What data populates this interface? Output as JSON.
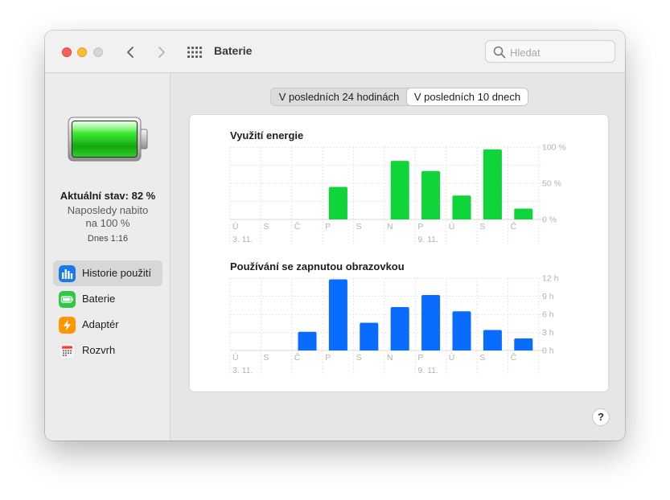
{
  "window": {
    "title": "Baterie"
  },
  "search": {
    "placeholder": "Hledat"
  },
  "sidebar": {
    "status_main": "Aktuální stav: 82 %",
    "status_sub_1": "Naposledy nabito",
    "status_sub_2": "na 100 %",
    "status_time": "Dnes 1:16",
    "items": [
      {
        "label": "Historie použití",
        "icon": "bar-chart-icon",
        "color": "#1778f2",
        "active": true
      },
      {
        "label": "Baterie",
        "icon": "battery-icon",
        "color": "#33c748",
        "active": false
      },
      {
        "label": "Adaptér",
        "icon": "lightning-icon",
        "color": "#ff9500",
        "active": false
      },
      {
        "label": "Rozvrh",
        "icon": "calendar-icon",
        "color": "#f2f2f2",
        "active": false
      }
    ]
  },
  "tabs": [
    {
      "label": "V posledních 24 hodinách",
      "selected": false
    },
    {
      "label": "V posledních 10 dnech",
      "selected": true
    }
  ],
  "help": {
    "label": "?"
  },
  "chart_data": [
    {
      "type": "bar",
      "title": "Využití energie",
      "color": "#0fd43a",
      "categories": [
        "Ú",
        "S",
        "Č",
        "P",
        "S",
        "N",
        "P",
        "Ú",
        "S",
        "Č"
      ],
      "date_labels": [
        {
          "index": 0,
          "text": "3. 11."
        },
        {
          "index": 6,
          "text": "9. 11."
        }
      ],
      "values": [
        0,
        0,
        0,
        45,
        0,
        81,
        67,
        33,
        97,
        15
      ],
      "ylim": [
        0,
        100
      ],
      "yticks": [
        {
          "v": 100,
          "label": "100 %"
        },
        {
          "v": 50,
          "label": "50 %"
        },
        {
          "v": 0,
          "label": "0 %"
        }
      ]
    },
    {
      "type": "bar",
      "title": "Používání se zapnutou obrazovkou",
      "color": "#0a6cff",
      "categories": [
        "Ú",
        "S",
        "Č",
        "P",
        "S",
        "N",
        "P",
        "Ú",
        "S",
        "Č"
      ],
      "date_labels": [
        {
          "index": 0,
          "text": "3. 11."
        },
        {
          "index": 6,
          "text": "9. 11."
        }
      ],
      "values": [
        0,
        0,
        3.1,
        11.8,
        4.6,
        7.2,
        9.2,
        6.5,
        3.4,
        2.0
      ],
      "ylim": [
        0,
        12
      ],
      "yticks": [
        {
          "v": 12,
          "label": "12 h"
        },
        {
          "v": 9,
          "label": "9 h"
        },
        {
          "v": 6,
          "label": "6 h"
        },
        {
          "v": 3,
          "label": "3 h"
        },
        {
          "v": 0,
          "label": "0 h"
        }
      ]
    }
  ]
}
